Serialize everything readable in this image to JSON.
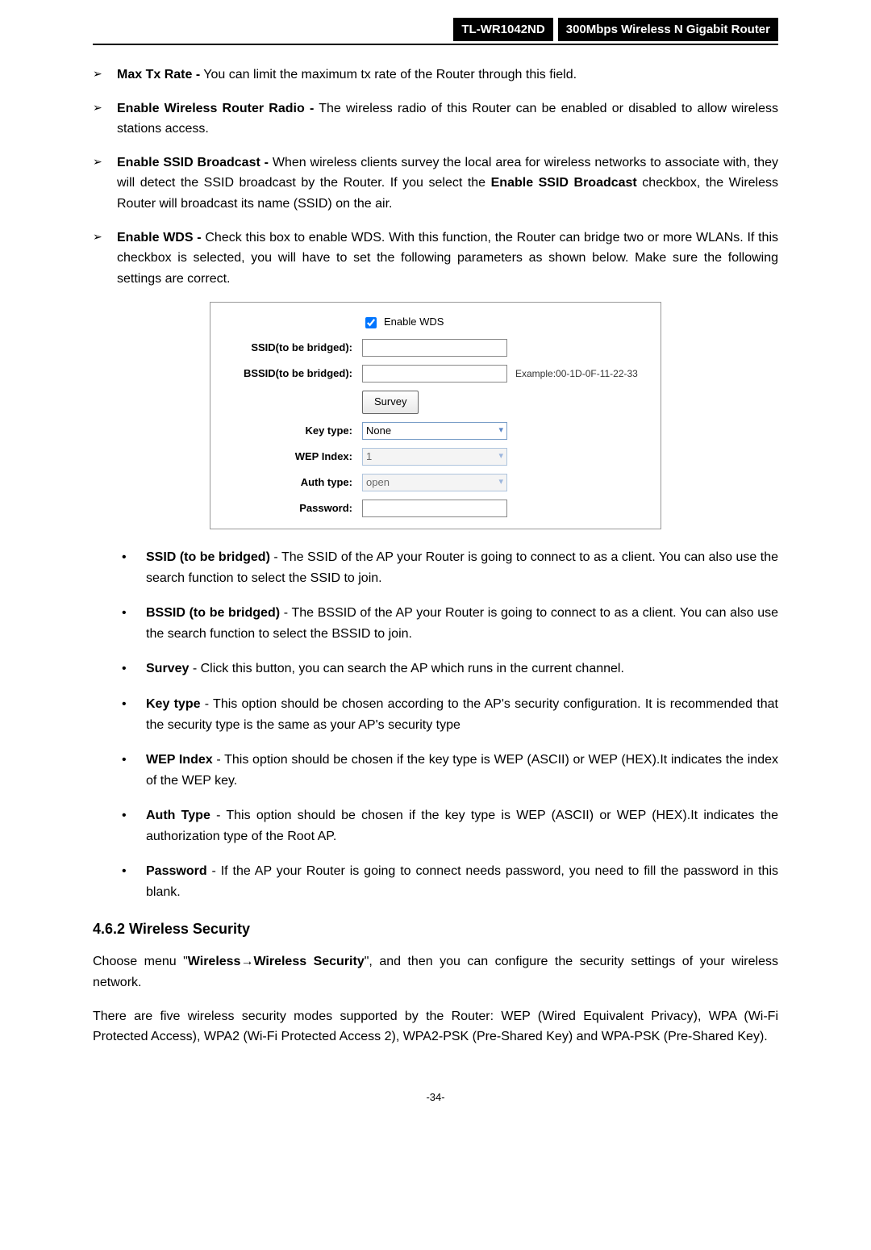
{
  "header": {
    "model": "TL-WR1042ND",
    "product": "300Mbps Wireless N Gigabit Router"
  },
  "bullets": [
    {
      "title": "Max Tx Rate -",
      "body": " You can limit the maximum tx rate of the Router through this field."
    },
    {
      "title": "Enable Wireless Router Radio -",
      "body": " The wireless radio of this Router can be enabled or disabled to allow wireless stations access."
    },
    {
      "title": "Enable SSID Broadcast -",
      "body": " When wireless clients survey the local area for wireless networks to associate with, they will detect the SSID broadcast by the Router. If you select the ",
      "title2": "Enable SSID Broadcast",
      "body2": " checkbox, the Wireless Router will broadcast its name (SSID) on the air."
    },
    {
      "title": "Enable WDS -",
      "body": " Check this box to enable WDS. With this function, the Router can bridge two or more WLANs. If this checkbox is selected, you will have to set the following parameters as shown below. Make sure the following settings are correct."
    }
  ],
  "panel": {
    "enable_wds_label": "Enable WDS",
    "rows": {
      "ssid_label": "SSID(to be bridged):",
      "bssid_label": "BSSID(to be bridged):",
      "bssid_example": "Example:00-1D-0F-11-22-33",
      "survey_btn": "Survey",
      "key_type_label": "Key type:",
      "key_type_value": "None",
      "wep_index_label": "WEP Index:",
      "wep_index_value": "1",
      "auth_type_label": "Auth type:",
      "auth_type_value": "open",
      "password_label": "Password:"
    }
  },
  "sub_bullets": [
    {
      "title": "SSID (to be bridged)",
      "body": " - The SSID of the AP your Router is going to connect to as a client. You can also use the search function to select the SSID to join."
    },
    {
      "title": "BSSID (to be bridged)",
      "body": " - The BSSID of the AP your Router is going to connect to as a client. You can also use the search function to select the BSSID to join."
    },
    {
      "title": "Survey",
      "body": " - Click this button, you can search the AP which runs in the current channel."
    },
    {
      "title": "Key type",
      "body": " - This option should be chosen according to the AP's security configuration. It is recommended that the security type is the same as your AP's security type"
    },
    {
      "title": "WEP Index",
      "body": " - This option should be chosen if the key type is WEP (ASCII) or WEP (HEX).It indicates the index of the WEP key."
    },
    {
      "title": "Auth Type",
      "body": " - This option should be chosen if the key type is WEP (ASCII) or WEP (HEX).It indicates the authorization type of the Root AP."
    },
    {
      "title": "Password",
      "body": " - If the AP your Router is going to connect needs password, you need to fill the password in this blank."
    }
  ],
  "section": {
    "heading": "4.6.2   Wireless Security",
    "para1_pre": "Choose menu \"",
    "para1_b1": "Wireless",
    "para1_arrow": "→",
    "para1_b2": "Wireless Security",
    "para1_post": "\", and then you can configure the security settings of your wireless network.",
    "para2": "There are five wireless security modes supported by the Router: WEP (Wired Equivalent Privacy), WPA (Wi-Fi Protected Access), WPA2 (Wi-Fi Protected Access 2), WPA2-PSK (Pre-Shared Key) and WPA-PSK (Pre-Shared Key)."
  },
  "footer": "-34-"
}
